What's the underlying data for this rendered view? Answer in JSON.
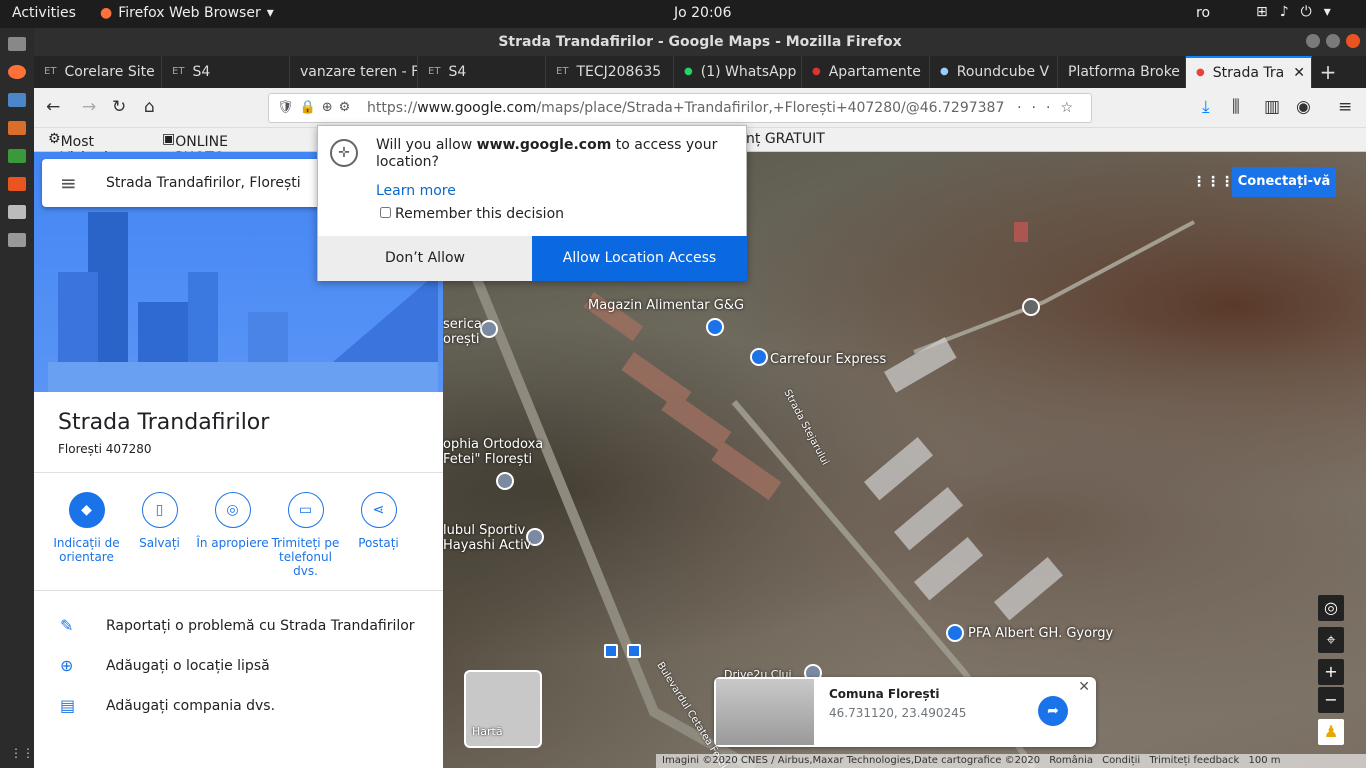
{
  "gnome": {
    "activities": "Activities",
    "app_name": "Firefox Web Browser",
    "clock": "Jo 20:06",
    "lang": "ro"
  },
  "window": {
    "title": "Strada Trandafirilor - Google Maps - Mozilla Firefox"
  },
  "tabs": [
    {
      "label": "Corelare Site"
    },
    {
      "label": "S4"
    },
    {
      "label": "vanzare teren - F"
    },
    {
      "label": "S4"
    },
    {
      "label": "TECJ208635"
    },
    {
      "label": "(1) WhatsApp"
    },
    {
      "label": "Apartamente"
    },
    {
      "label": "Roundcube V"
    },
    {
      "label": "Platforma Broke"
    },
    {
      "label": "Strada Tra"
    }
  ],
  "url": {
    "prefix": "https://",
    "host": "www.google.com",
    "path": "/maps/place/Strada+Trandafirilor,+Florești+407280/@46.7297387"
  },
  "bookmarks": {
    "most_visited": "Most Visited",
    "photo": "ONLINE PHOTO EDI",
    "gratuit": "nț GRATUIT"
  },
  "popup": {
    "question_pre": "Will you allow ",
    "question_host": "www.google.com",
    "question_post": " to access your location?",
    "learn_more": "Learn more",
    "remember": "Remember this decision",
    "deny": "Don’t Allow",
    "allow": "Allow Location Access"
  },
  "sidebar": {
    "search_value": "Strada Trandafirilor, Florești",
    "title": "Strada Trandafirilor",
    "subtitle": "Florești 407280",
    "actions": [
      {
        "label": "Indicații de orientare"
      },
      {
        "label": "Salvați"
      },
      {
        "label": "În apropiere"
      },
      {
        "label": "Trimiteți pe telefonul dvs."
      },
      {
        "label": "Postați"
      }
    ],
    "rows": [
      {
        "label": "Raportați o problemă cu Strada Trandafirilor"
      },
      {
        "label": "Adăugați o locație lipsă"
      },
      {
        "label": "Adăugați compania dvs."
      }
    ]
  },
  "map": {
    "signin": "Conectați-vă",
    "labels": {
      "magazin": "Magazin Alimentar G&G",
      "carrefour": "Carrefour Express",
      "biserica": "serica\norești",
      "sophia": "ophia Ortodoxa\nFetei\" Florești",
      "clubul": "lubul Sportiv\nHayashi Activ",
      "pfa": "PFA Albert GH. Gyorgy",
      "drive": "Drive2u Cluj",
      "strada": "Strada Stejarului",
      "bulevard": "Bulevardul Cetatea Fetei"
    },
    "minimap_label": "Hartă",
    "card": {
      "title": "Comuna Florești",
      "coords": "46.731120, 23.490245"
    },
    "footer": {
      "imagery": "Imagini ©2020 CNES / Airbus,Maxar Technologies,Date cartografice ©2020",
      "country": "România",
      "terms": "Condiții",
      "feedback": "Trimiteți feedback",
      "scale": "100 m"
    }
  }
}
